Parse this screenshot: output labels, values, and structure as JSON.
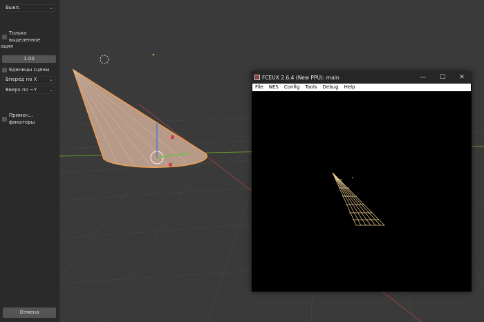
{
  "panel": {
    "mode_select": "Выкл.",
    "only_selected": "Только выделенное",
    "section_label": "ация",
    "scale_value": "1.00",
    "scene_units": "Единицы сцены",
    "forward_select": "Вперёд по X",
    "up_select": "Вверх по −Y",
    "apply_modifiers": "Примен…фикаторы",
    "cancel": "Отмена"
  },
  "fceux": {
    "title": "FCEUX 2.6.4 (New PPU): main",
    "menu": [
      "File",
      "NES",
      "Config",
      "Tools",
      "Debug",
      "Help"
    ],
    "minimize": "—",
    "maximize": "☐",
    "close": "✕"
  },
  "colors": {
    "viewport": "#3a3a3a",
    "cone": "#e0a070",
    "nes_cone": "#f0d090",
    "x_axis": "#b04040",
    "y_axis": "#6a9a30"
  }
}
